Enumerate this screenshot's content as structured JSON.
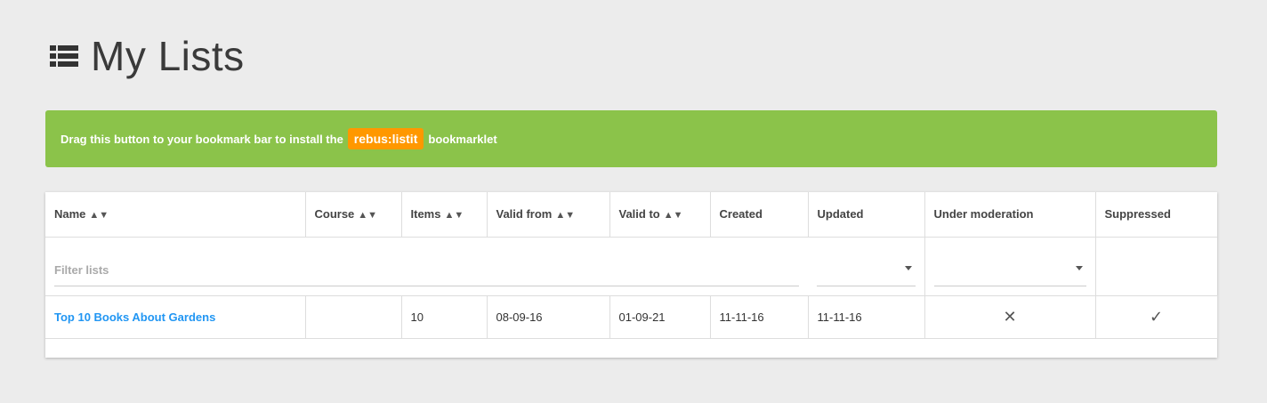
{
  "header": {
    "title": "My Lists",
    "icon": "list-icon"
  },
  "banner": {
    "text_before": "Drag this button to your bookmark bar to install the",
    "bookmarklet_label": "rebus:listit",
    "text_after": "bookmarklet",
    "bg_color": "#8bc34a",
    "button_color": "#ff9800"
  },
  "table": {
    "columns": [
      {
        "label": "Name",
        "sortable": true
      },
      {
        "label": "Course",
        "sortable": true
      },
      {
        "label": "Items",
        "sortable": true
      },
      {
        "label": "Valid from",
        "sortable": true
      },
      {
        "label": "Valid to",
        "sortable": true
      },
      {
        "label": "Created",
        "sortable": false
      },
      {
        "label": "Updated",
        "sortable": false
      },
      {
        "label": "Under moderation",
        "sortable": false
      },
      {
        "label": "Suppressed",
        "sortable": false
      }
    ],
    "filter_placeholder": "Filter lists",
    "updated_filter_value": "",
    "moderation_filter_value": "",
    "rows": [
      {
        "name": "Top 10 Books About Gardens",
        "course": "",
        "items": "10",
        "valid_from": "08-09-16",
        "valid_to": "01-09-21",
        "created": "11-11-16",
        "updated": "11-11-16",
        "under_moderation": "✕",
        "suppressed": "✓"
      }
    ],
    "link_color": "#2196f3"
  }
}
